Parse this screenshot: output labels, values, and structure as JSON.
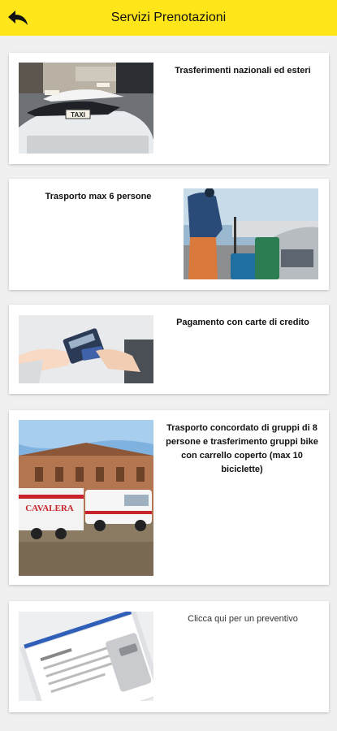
{
  "appbar": {
    "title": "Servizi Prenotazioni",
    "back_icon": "back-arrow-icon",
    "color": "#ffe61a"
  },
  "cards": [
    {
      "caption": "Trasferimenti nazionali ed esteri",
      "image": "taxi-rank-photo"
    },
    {
      "caption": "Trasporto max 6 persone",
      "image": "traveler-with-luggage-photo"
    },
    {
      "caption": "Pagamento con carte di credito",
      "image": "card-payment-terminal-photo"
    },
    {
      "caption": "Trasporto concordato di gruppi di 8 persone e trasferimento gruppi bike con carrello coperto (max 10 biciclette)",
      "image": "vans-with-trailer-photo",
      "van_text": "CAVALERA"
    },
    {
      "caption": "Clicca qui per un preventivo",
      "image": "quote-clipboard-photo"
    }
  ]
}
